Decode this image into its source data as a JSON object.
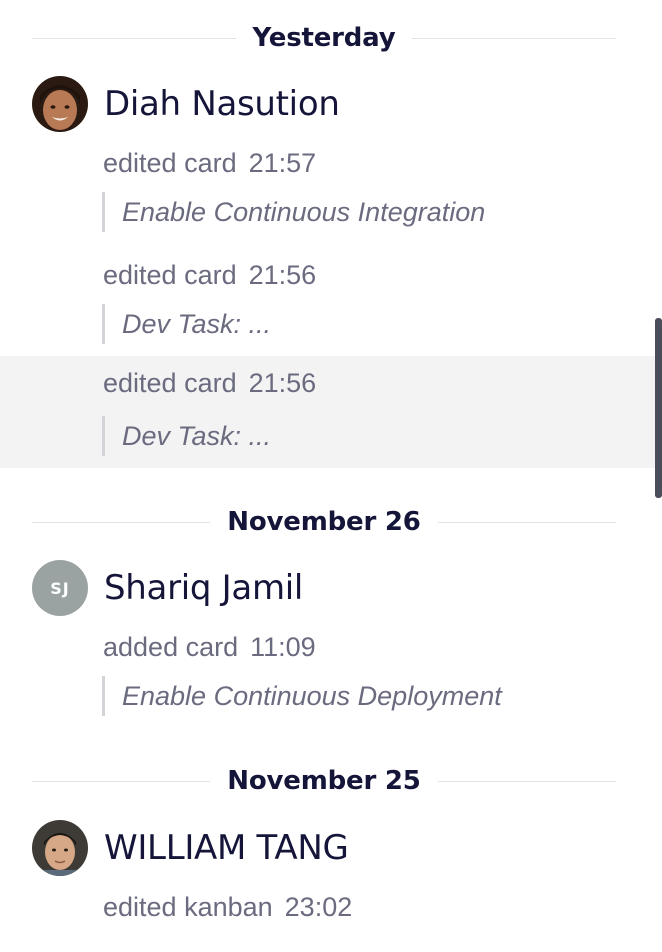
{
  "groups": [
    {
      "date": "Yesterday",
      "user": {
        "name": "Diah Nasution",
        "avatar": "photo",
        "avatar_desc": "avatar-photo-icon"
      },
      "activities": [
        {
          "action": "edited card",
          "time": "21:57",
          "card": "Enable Continuous Integration"
        },
        {
          "action": "edited card",
          "time": "21:56",
          "card": "Dev Task: ..."
        },
        {
          "action": "edited card",
          "time": "21:56",
          "card": "Dev Task: ...",
          "highlighted": true
        }
      ]
    },
    {
      "date": "November 26",
      "user": {
        "name": "Shariq Jamil",
        "avatar": "initials",
        "initials": "SJ",
        "avatar_color": "#9aa3a2"
      },
      "activities": [
        {
          "action": "added card",
          "time": "11:09",
          "card": "Enable Continuous Deployment"
        }
      ]
    },
    {
      "date": "November 25",
      "user": {
        "name": "WILLIAM TANG",
        "avatar": "photo",
        "avatar_desc": "avatar-photo-icon"
      },
      "activities": [
        {
          "action": "edited kanban",
          "time": "23:02",
          "card": ""
        }
      ]
    }
  ],
  "colors": {
    "heading": "#15153a",
    "muted_text": "#6b6b80",
    "quote_bar": "#d3d3da",
    "highlight_bg": "#f3f3f4",
    "scrollbar": "#4a4d5a"
  }
}
